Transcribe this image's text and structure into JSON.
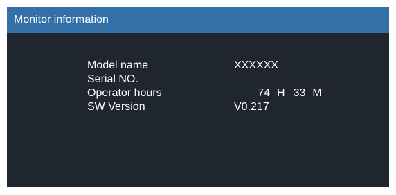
{
  "header": {
    "title": "Monitor information"
  },
  "info": {
    "model_name": {
      "label": "Model name",
      "value": "XXXXXX"
    },
    "serial_no": {
      "label": "Serial NO.",
      "value": ""
    },
    "operator_hours": {
      "label": "Operator hours",
      "hours": "74",
      "hours_unit": "H",
      "minutes": "33",
      "minutes_unit": "M"
    },
    "sw_version": {
      "label": "SW Version",
      "value": "V0.217"
    }
  },
  "colors": {
    "header_bg": "#3370a8",
    "panel_bg": "#1f262d",
    "text": "#ffffff"
  }
}
